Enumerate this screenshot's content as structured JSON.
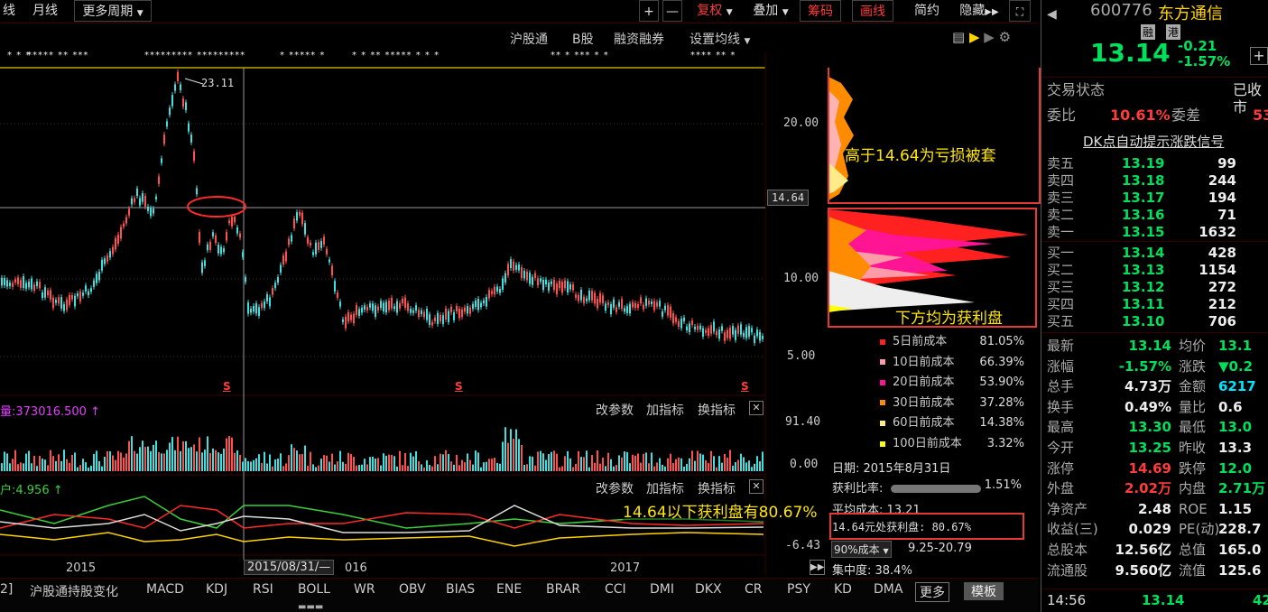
{
  "toolbar": {
    "tab_partial": "线",
    "monthly": "月线",
    "more_periods": "更多周期",
    "zoom_in": "+",
    "zoom_out": "—",
    "restore_rights": "复权",
    "overlay": "叠加",
    "chips": "筹码",
    "draw_line": "画线",
    "simple": "简约",
    "hide": "隐藏"
  },
  "subbar": {
    "hgt": "沪股通",
    "bshare": "B股",
    "margin": "融资融券",
    "set_ma": "设置均线"
  },
  "price_chart": {
    "peak_label": "23.11",
    "crosshair_price": "14.64",
    "y_ticks": [
      "20.00",
      "10.00",
      "5.00"
    ],
    "signal_marks": [
      "S",
      "S",
      "S"
    ]
  },
  "volume_panel": {
    "label": "量:373016.500",
    "ticks": [
      "91.40",
      "0.00"
    ],
    "btn_params": "改参数",
    "btn_add": "加指标",
    "btn_switch": "换指标"
  },
  "indicator_panel": {
    "label": "户:4.956",
    "ticks": [
      "-6.43"
    ],
    "btn_params": "改参数",
    "btn_add": "加指标",
    "btn_switch": "换指标"
  },
  "x_axis": {
    "y2015": "2015",
    "cursor_date": "2015/08/31/—",
    "y2016": "016",
    "y2017": "2017"
  },
  "annotations": {
    "above": "高于14.64为亏损被套",
    "below": "下方均为获利盘",
    "profit_note": "14.64以下获利盘有80.67%"
  },
  "chip_legend": [
    {
      "label": "5日前成本",
      "value": "81.05%",
      "color": "#ff2020"
    },
    {
      "label": "10日前成本",
      "value": "66.39%",
      "color": "#ff9aa8"
    },
    {
      "label": "20日前成本",
      "value": "53.90%",
      "color": "#ff1493"
    },
    {
      "label": "30日前成本",
      "value": "37.28%",
      "color": "#ff8c00"
    },
    {
      "label": "60日前成本",
      "value": "14.38%",
      "color": "#ffeb8a"
    },
    {
      "label": "100日前成本",
      "value": "3.32%",
      "color": "#ffff00"
    }
  ],
  "chip_stats": {
    "date": "日期: 2015年8月31日",
    "profit_ratio_label": "获利比率:",
    "profit_ratio": "1.51%",
    "avg_cost": "平均成本: 13.21",
    "profit_at": "14.64元处获利盘: 80.67%",
    "cost90": "90%成本",
    "cost90_range": "9.25-20.79",
    "concentration": "集中度: 38.4%"
  },
  "quote": {
    "code": "600776",
    "name": "东方通信",
    "price": "13.14",
    "change": "-0.21",
    "pct": "-1.57%",
    "tag_rong": "融",
    "tag_gang": "港",
    "status_label": "交易状态",
    "status_value": "已收市",
    "weibi_label": "委比",
    "weibi": "10.61%",
    "weicha_label": "委差",
    "weicha": "53",
    "dk_link": "DK点自动提示涨跌信号"
  },
  "asks": [
    {
      "label": "卖五",
      "price": "13.19",
      "vol": "99"
    },
    {
      "label": "卖四",
      "price": "13.18",
      "vol": "244"
    },
    {
      "label": "卖三",
      "price": "13.17",
      "vol": "194"
    },
    {
      "label": "卖二",
      "price": "13.16",
      "vol": "71"
    },
    {
      "label": "卖一",
      "price": "13.15",
      "vol": "1632"
    }
  ],
  "bids": [
    {
      "label": "买一",
      "price": "13.14",
      "vol": "428"
    },
    {
      "label": "买二",
      "price": "13.13",
      "vol": "1154"
    },
    {
      "label": "买三",
      "price": "13.12",
      "vol": "272"
    },
    {
      "label": "买四",
      "price": "13.11",
      "vol": "212"
    },
    {
      "label": "买五",
      "price": "13.10",
      "vol": "706"
    }
  ],
  "stats": [
    {
      "k1": "最新",
      "v1": "13.14",
      "c1": "#00e05c",
      "k2": "均价",
      "v2": "13.1",
      "c2": "#00e05c"
    },
    {
      "k1": "涨幅",
      "v1": "-1.57%",
      "c1": "#00e05c",
      "k2": "涨跌",
      "v2": "▼0.2",
      "c2": "#00e05c"
    },
    {
      "k1": "总手",
      "v1": "4.73万",
      "c1": "#eee",
      "k2": "金额",
      "v2": "6217",
      "c2": "#00e5ff"
    },
    {
      "k1": "换手",
      "v1": "0.49%",
      "c1": "#eee",
      "k2": "量比",
      "v2": "0.6",
      "c2": "#eee"
    },
    {
      "k1": "最高",
      "v1": "13.30",
      "c1": "#00e05c",
      "k2": "最低",
      "v2": "13.0",
      "c2": "#00e05c"
    },
    {
      "k1": "今开",
      "v1": "13.25",
      "c1": "#00e05c",
      "k2": "昨收",
      "v2": "13.3",
      "c2": "#eee"
    },
    {
      "k1": "涨停",
      "v1": "14.69",
      "c1": "#ff3b3b",
      "k2": "跌停",
      "v2": "12.0",
      "c2": "#00e05c"
    },
    {
      "k1": "外盘",
      "v1": "2.02万",
      "c1": "#ff3b3b",
      "k2": "内盘",
      "v2": "2.71万",
      "c2": "#00e05c"
    },
    {
      "k1": "净资产",
      "v1": "2.48",
      "c1": "#eee",
      "k2": "ROE",
      "v2": "1.15",
      "c2": "#eee"
    },
    {
      "k1": "收益(三)",
      "v1": "0.029",
      "c1": "#eee",
      "k2": "PE(动)",
      "v2": "228.7",
      "c2": "#eee"
    },
    {
      "k1": "总股本",
      "v1": "12.56亿",
      "c1": "#eee",
      "k2": "总值",
      "v2": "165.0",
      "c2": "#eee"
    },
    {
      "k1": "流通股",
      "v1": "9.560亿",
      "c1": "#eee",
      "k2": "流值",
      "v2": "125.6",
      "c2": "#eee"
    }
  ],
  "tick": {
    "time": "14:56",
    "price": "13.14",
    "vol": "42"
  },
  "indicators": [
    "2]",
    "沪股通持股变化",
    "MACD",
    "KDJ",
    "RSI",
    "BOLL",
    "WR",
    "OBV",
    "BIAS",
    "ENE",
    "BRAR",
    "CCI",
    "DMI",
    "DKX",
    "CR",
    "PSY",
    "KD",
    "DMA"
  ],
  "more_btn": "更多",
  "template_btn": "模板"
}
